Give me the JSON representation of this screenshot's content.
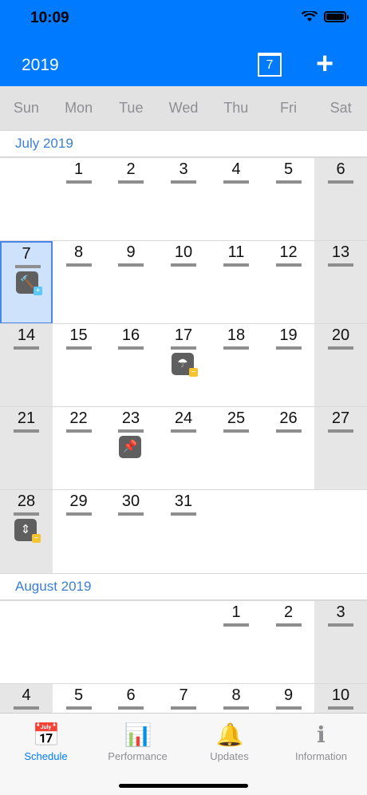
{
  "status_bar": {
    "time": "10:09"
  },
  "header": {
    "title": "2019",
    "today_label": "7",
    "add_label": "+"
  },
  "weekdays": [
    "Sun",
    "Mon",
    "Tue",
    "Wed",
    "Thu",
    "Fri",
    "Sat"
  ],
  "months": [
    {
      "name": "July 2019",
      "weeks": [
        [
          "",
          "1",
          "2",
          "3",
          "4",
          "5",
          "6"
        ],
        [
          "7",
          "8",
          "9",
          "10",
          "11",
          "12",
          "13"
        ],
        [
          "14",
          "15",
          "16",
          "17",
          "18",
          "19",
          "20"
        ],
        [
          "21",
          "22",
          "23",
          "24",
          "25",
          "26",
          "27"
        ],
        [
          "28",
          "29",
          "30",
          "31",
          "",
          "",
          ""
        ]
      ]
    },
    {
      "name": "August 2019",
      "weeks": [
        [
          "",
          "",
          "",
          "",
          "1",
          "2",
          "3"
        ],
        [
          "4",
          "5",
          "6",
          "7",
          "8",
          "9",
          "10"
        ]
      ]
    }
  ],
  "today": "July 7",
  "events": [
    {
      "day": "7",
      "icon": "gavel-icon",
      "glyph": "🔨",
      "badge": "+"
    },
    {
      "day": "17",
      "icon": "umbrella-icon",
      "glyph": "☂",
      "badge": "−"
    },
    {
      "day": "23",
      "icon": "pushpin-icon",
      "glyph": "📌",
      "badge": ""
    },
    {
      "day": "28",
      "icon": "adjust-icon",
      "glyph": "⇕",
      "badge": "−"
    }
  ],
  "tabs": [
    {
      "label": "Schedule",
      "icon": "calendar-clock-icon",
      "glyph": "📅",
      "active": true
    },
    {
      "label": "Performance",
      "icon": "chart-icon",
      "glyph": "📊",
      "active": false
    },
    {
      "label": "Updates",
      "icon": "bell-icon",
      "glyph": "🔔",
      "active": false
    },
    {
      "label": "Information",
      "icon": "info-icon",
      "glyph": "ℹ",
      "active": false
    }
  ],
  "colors": {
    "accent": "#007aff",
    "weekend_bg": "#e6e6e6",
    "today_bg": "#cfe2fb",
    "month_label": "#3a7fd5"
  }
}
